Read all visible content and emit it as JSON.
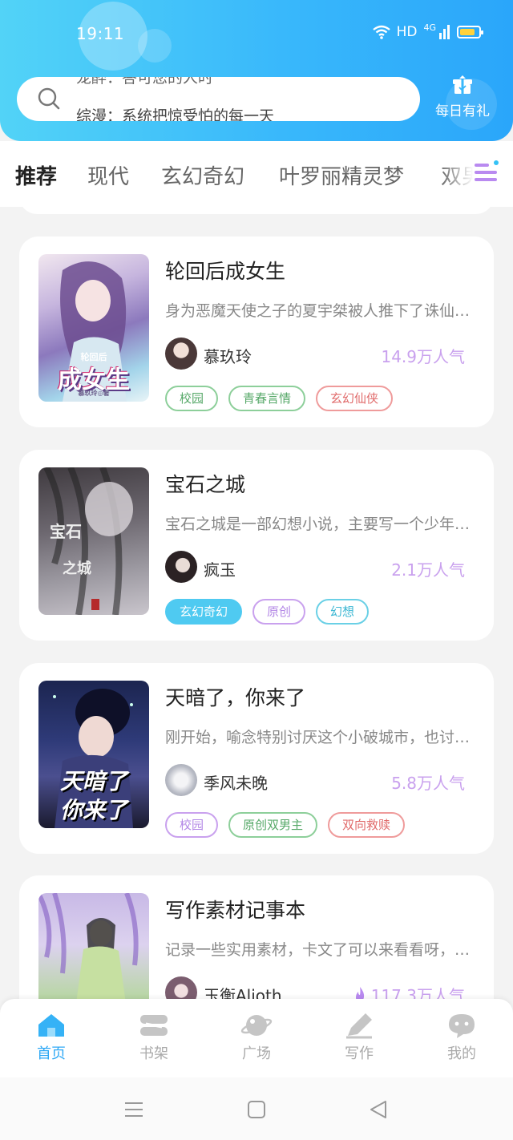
{
  "status_bar": {
    "time": "19:11",
    "signal_label": "HD",
    "network": "4G"
  },
  "search": {
    "previous_hint": "宠醉：答可您的人时",
    "current_hint": "综漫：系统把惊受怕的每一天"
  },
  "daily_gift": {
    "label": "每日有礼"
  },
  "tabs": [
    {
      "label": "推荐",
      "active": true
    },
    {
      "label": "现代"
    },
    {
      "label": "玄幻奇幻"
    },
    {
      "label": "叶罗丽精灵梦"
    },
    {
      "label": "双男"
    }
  ],
  "books": [
    {
      "title": "轮回后成女生",
      "description": "身为恶魔天使之子的夏宇桀被人推下了诛仙台，再次醒来",
      "author": "慕玖玲",
      "popularity": "14.9万人气",
      "tags": [
        {
          "label": "校园",
          "style": "green"
        },
        {
          "label": "青春言情",
          "style": "green"
        },
        {
          "label": "玄幻仙侠",
          "style": "red"
        }
      ],
      "cover_text_small": "轮回后",
      "cover_text_big": "成女生",
      "cover_author": "慕玖玲◎著"
    },
    {
      "title": "宝石之城",
      "description": "宝石之城是一部幻想小说，主要写一个少年的冒险故事",
      "author": "疯玉",
      "popularity": "2.1万人气",
      "tags": [
        {
          "label": "玄幻奇幻",
          "style": "filled"
        },
        {
          "label": "原创",
          "style": "purple"
        },
        {
          "label": "幻想",
          "style": "teal"
        }
      ],
      "cover_text_small": "宝石",
      "cover_text_big": "之城"
    },
    {
      "title": "天暗了，你来了",
      "description": "刚开始，喻念特别讨厌这个小破城市，也讨厌这里的人",
      "author": "季风未晚",
      "popularity": "5.8万人气",
      "tags": [
        {
          "label": "校园",
          "style": "purple"
        },
        {
          "label": "原创双男主",
          "style": "green"
        },
        {
          "label": "双向救赎",
          "style": "red"
        }
      ],
      "cover_text_small": "天暗了",
      "cover_text_big": "你来了"
    },
    {
      "title": "写作素材记事本",
      "description": "记录一些实用素材，卡文了可以来看看呀，欢迎大家",
      "author": "玉衡Alioth",
      "popularity": "117.3万人气",
      "tags": []
    }
  ],
  "bottom_nav": [
    {
      "label": "首页",
      "icon": "home-icon",
      "active": true
    },
    {
      "label": "书架",
      "icon": "bookshelf-icon"
    },
    {
      "label": "广场",
      "icon": "planet-icon"
    },
    {
      "label": "写作",
      "icon": "pen-icon"
    },
    {
      "label": "我的",
      "icon": "profile-icon"
    }
  ],
  "colors": {
    "accent": "#2ea8f5",
    "tab_indicator": "#b98af0",
    "popularity": "#c9a1ee"
  }
}
